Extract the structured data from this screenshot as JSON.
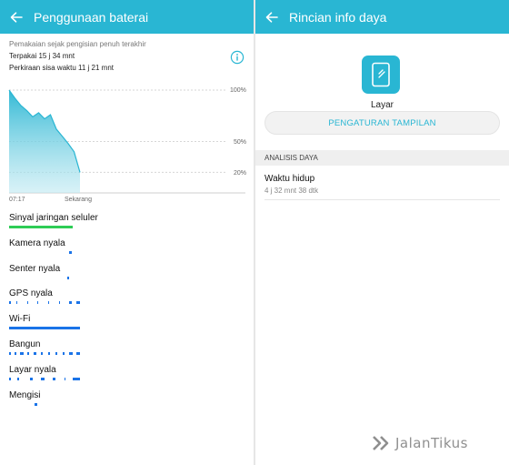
{
  "left": {
    "appbar": {
      "title": "Penggunaan baterai"
    },
    "summary": {
      "since_label": "Pemakaian sejak pengisian penuh terakhir",
      "used": "Terpakai 15 j 34 mnt",
      "remaining": "Perkiraan sisa waktu 11 j 21 mnt"
    },
    "chart_data": {
      "type": "area",
      "x": [
        "07:17",
        "",
        "",
        "",
        "",
        "",
        "",
        "",
        "",
        "",
        "",
        "",
        "Sekarang"
      ],
      "values": [
        100,
        92,
        85,
        80,
        74,
        78,
        72,
        76,
        62,
        55,
        48,
        40,
        20
      ],
      "y_ticks": [
        "100%",
        "50%",
        "20%"
      ],
      "x_start_label": "07:17",
      "x_end_label": "Sekarang",
      "ylim": [
        0,
        100
      ],
      "grid": true,
      "color": "#29b6d3"
    },
    "usage": [
      {
        "label": "Sinyal jaringan seluler",
        "color": "#2ecc55",
        "segments": [
          [
            0,
            0.9
          ]
        ]
      },
      {
        "label": "Kamera nyala",
        "color": "#1a73e8",
        "segments": [
          [
            0.85,
            0.88
          ]
        ]
      },
      {
        "label": "Senter nyala",
        "color": "#1a73e8",
        "segments": [
          [
            0.82,
            0.84
          ]
        ]
      },
      {
        "label": "GPS nyala",
        "color": "#1a73e8",
        "segments": [
          [
            0,
            0.02
          ],
          [
            0.1,
            0.12
          ],
          [
            0.25,
            0.27
          ],
          [
            0.4,
            0.41
          ],
          [
            0.55,
            0.57
          ],
          [
            0.7,
            0.72
          ],
          [
            0.85,
            0.88
          ],
          [
            0.95,
            1.0
          ]
        ]
      },
      {
        "label": "Wi-Fi",
        "color": "#1a73e8",
        "segments": [
          [
            0,
            1.0
          ]
        ]
      },
      {
        "label": "Bangun",
        "color": "#1a73e8",
        "segments": [
          [
            0,
            0.03
          ],
          [
            0.08,
            0.1
          ],
          [
            0.15,
            0.2
          ],
          [
            0.26,
            0.28
          ],
          [
            0.35,
            0.38
          ],
          [
            0.45,
            0.48
          ],
          [
            0.55,
            0.58
          ],
          [
            0.65,
            0.68
          ],
          [
            0.75,
            0.78
          ],
          [
            0.85,
            0.9
          ],
          [
            0.95,
            1.0
          ]
        ]
      },
      {
        "label": "Layar nyala",
        "color": "#1a73e8",
        "segments": [
          [
            0,
            0.02
          ],
          [
            0.12,
            0.14
          ],
          [
            0.3,
            0.33
          ],
          [
            0.45,
            0.5
          ],
          [
            0.62,
            0.65
          ],
          [
            0.78,
            0.8
          ],
          [
            0.9,
            1.0
          ]
        ]
      },
      {
        "label": "Mengisi",
        "color": "#1a73e8",
        "segments": [
          [
            0.36,
            0.4
          ]
        ]
      }
    ]
  },
  "right": {
    "appbar": {
      "title": "Rincian info daya"
    },
    "app_name": "Layar",
    "settings_button": "PENGATURAN TAMPILAN",
    "section_header": "ANALISIS DAYA",
    "stat_label": "Waktu hidup",
    "stat_value": "4 j 32 mnt 38 dtk"
  },
  "watermark": {
    "text": "JalanTikus"
  },
  "icons": {
    "back": "arrow-left-icon",
    "info": "info-icon",
    "screen": "phone-screen-icon",
    "watermark": "jalantikus-logo-icon"
  },
  "colors": {
    "accent": "#29b6d3",
    "green": "#2ecc55",
    "blue": "#1a73e8"
  }
}
